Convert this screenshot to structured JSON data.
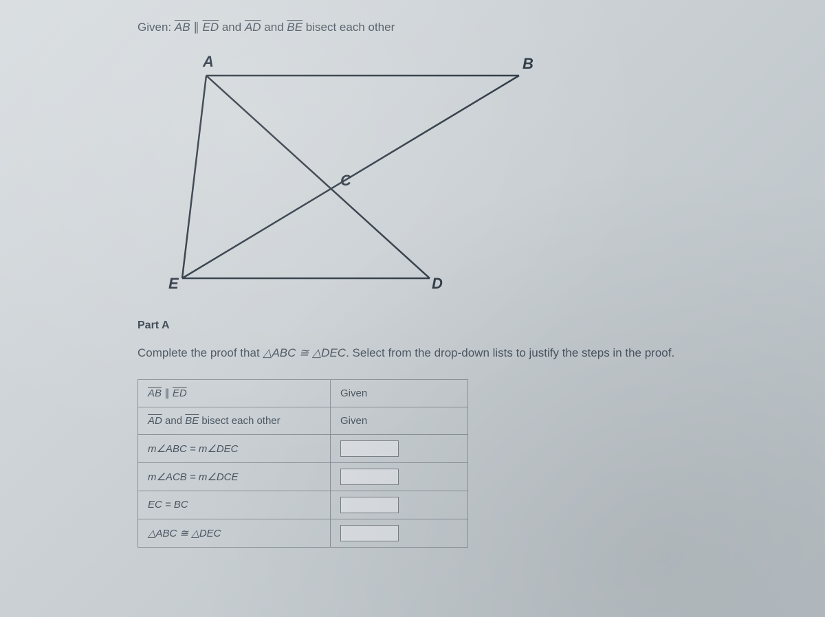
{
  "given": {
    "prefix": "Given: ",
    "seg1_a": "AB",
    "par": " ∥ ",
    "seg1_b": "ED",
    "and1": " and ",
    "seg2_a": "AD",
    "and2": " and ",
    "seg2_b": "BE",
    "suffix": " bisect each other"
  },
  "labels": {
    "A": "A",
    "B": "B",
    "C": "C",
    "D": "D",
    "E": "E"
  },
  "partA": {
    "heading": "Part A",
    "instr_prefix": "Complete the proof that ",
    "instr_tri1": "△ABC ≅ △DEC",
    "instr_suffix": ". Select from the drop-down lists to justify the steps in the proof."
  },
  "proof": {
    "rows": [
      {
        "stmt_a": "AB",
        "stmt_mid": " ∥ ",
        "stmt_b": "ED",
        "reason": "Given",
        "has_dropdown": false
      },
      {
        "stmt_a": "AD",
        "stmt_mid": " and ",
        "stmt_b": "BE",
        "stmt_suffix": " bisect each other",
        "reason": "Given",
        "has_dropdown": false
      },
      {
        "stmt_plain": "m∠ABC = m∠DEC",
        "has_dropdown": true
      },
      {
        "stmt_plain": "m∠ACB = m∠DCE",
        "has_dropdown": true
      },
      {
        "stmt_plain": "EC = BC",
        "has_dropdown": true
      },
      {
        "stmt_plain": "△ABC ≅ △DEC",
        "has_dropdown": true
      }
    ]
  }
}
